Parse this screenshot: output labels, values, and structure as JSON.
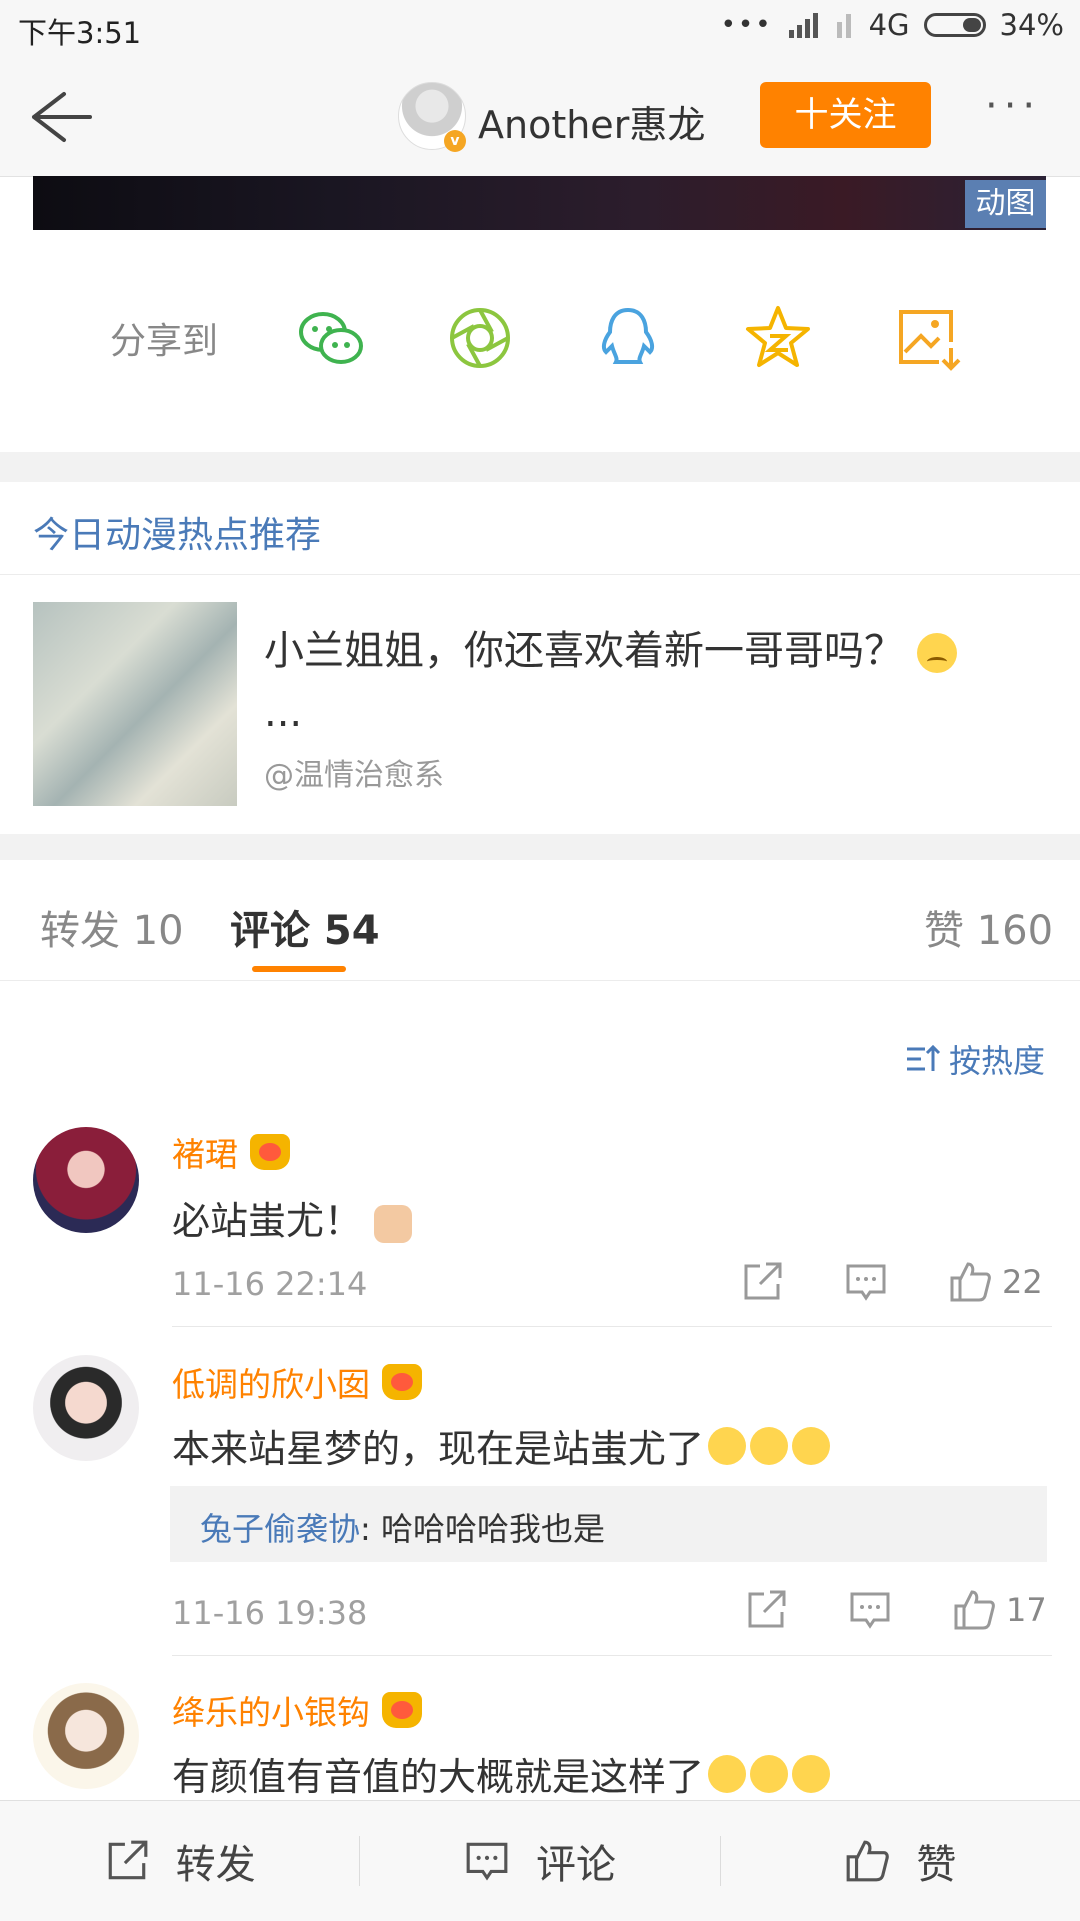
{
  "status_bar": {
    "time": "下午3:51",
    "network": "4G",
    "battery": "34%"
  },
  "nav": {
    "title": "Another惠龙",
    "follow_label": "十关注",
    "more": "···"
  },
  "gif": {
    "badge": "动图"
  },
  "share": {
    "label": "分享到",
    "targets": [
      "wechat-icon",
      "moments-icon",
      "qq-icon",
      "qzone-icon",
      "save-image-icon"
    ],
    "colors": {
      "wechat": "#3fb34f",
      "moments": "#8cc63f",
      "qq": "#4aa3df",
      "qzone": "#f5b400",
      "save": "#f5a623"
    }
  },
  "recommend": {
    "section_title": "今日动漫热点推荐",
    "title": "小兰姐姐，你还喜欢着新一哥哥吗？",
    "ellipsis": "...",
    "source": "@温情治愈系"
  },
  "tabs": {
    "repost": "转发 10",
    "comments": "评论 54",
    "likes": "赞 160"
  },
  "sort": {
    "label": "按热度"
  },
  "comments": [
    {
      "name": "褚珺",
      "text": "必站蚩尤！",
      "time": "11-16 22:14",
      "likes": "22"
    },
    {
      "name": "低调的欣小囡",
      "text": "本来站星梦的，现在是站蚩尤了",
      "reply_name": "兔子偷袭协",
      "reply_text": ": 哈哈哈哈我也是",
      "time": "11-16 19:38",
      "likes": "17"
    },
    {
      "name": "绛乐的小银钩",
      "text": "有颜值有音值的大概就是这样了"
    }
  ],
  "bottom_bar": {
    "repost": "转发",
    "comment": "评论",
    "like": "赞"
  },
  "colors": {
    "accent": "#ff8200",
    "link": "#4a7ab8"
  }
}
